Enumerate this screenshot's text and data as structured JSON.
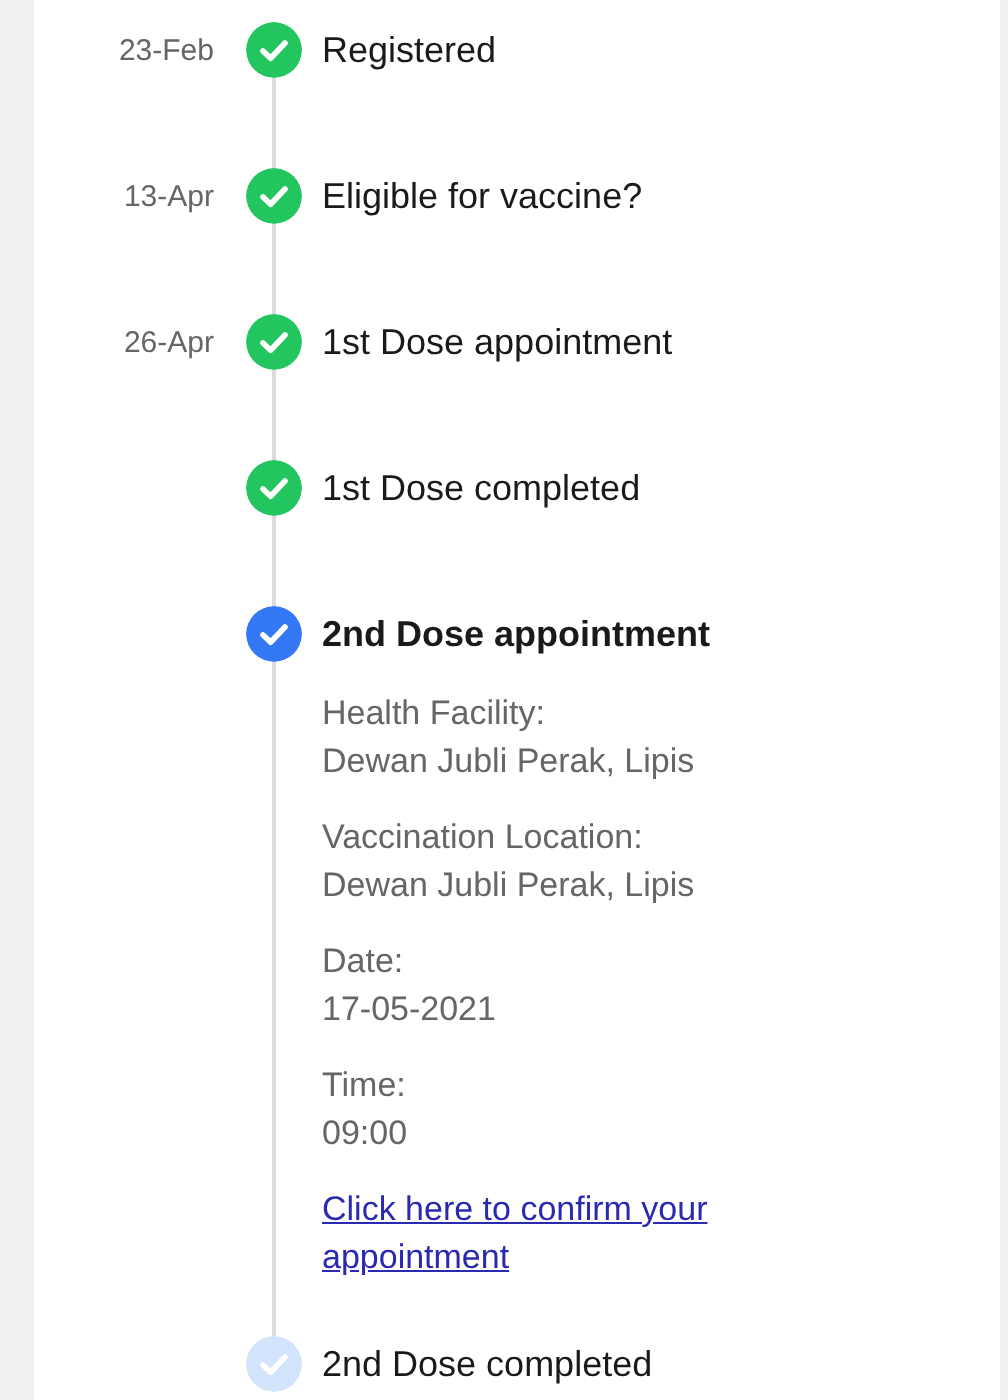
{
  "steps": [
    {
      "date": "23-Feb",
      "title": "Registered",
      "kind": "done"
    },
    {
      "date": "13-Apr",
      "title": "Eligible for vaccine?",
      "kind": "done"
    },
    {
      "date": "26-Apr",
      "title": "1st Dose appointment",
      "kind": "done"
    },
    {
      "title": "1st Dose completed",
      "kind": "done"
    },
    {
      "title": "2nd Dose appointment",
      "kind": "current",
      "details": [
        {
          "label": "Health Facility:",
          "value": "Dewan Jubli Perak, Lipis"
        },
        {
          "label": "Vaccination Location:",
          "value": "Dewan Jubli Perak, Lipis"
        },
        {
          "label": "Date:",
          "value": "17-05-2021"
        },
        {
          "label": "Time:",
          "value": "09:00"
        }
      ],
      "link": "Click here to confirm your appointment"
    },
    {
      "title": "2nd Dose completed",
      "kind": "pending"
    }
  ]
}
